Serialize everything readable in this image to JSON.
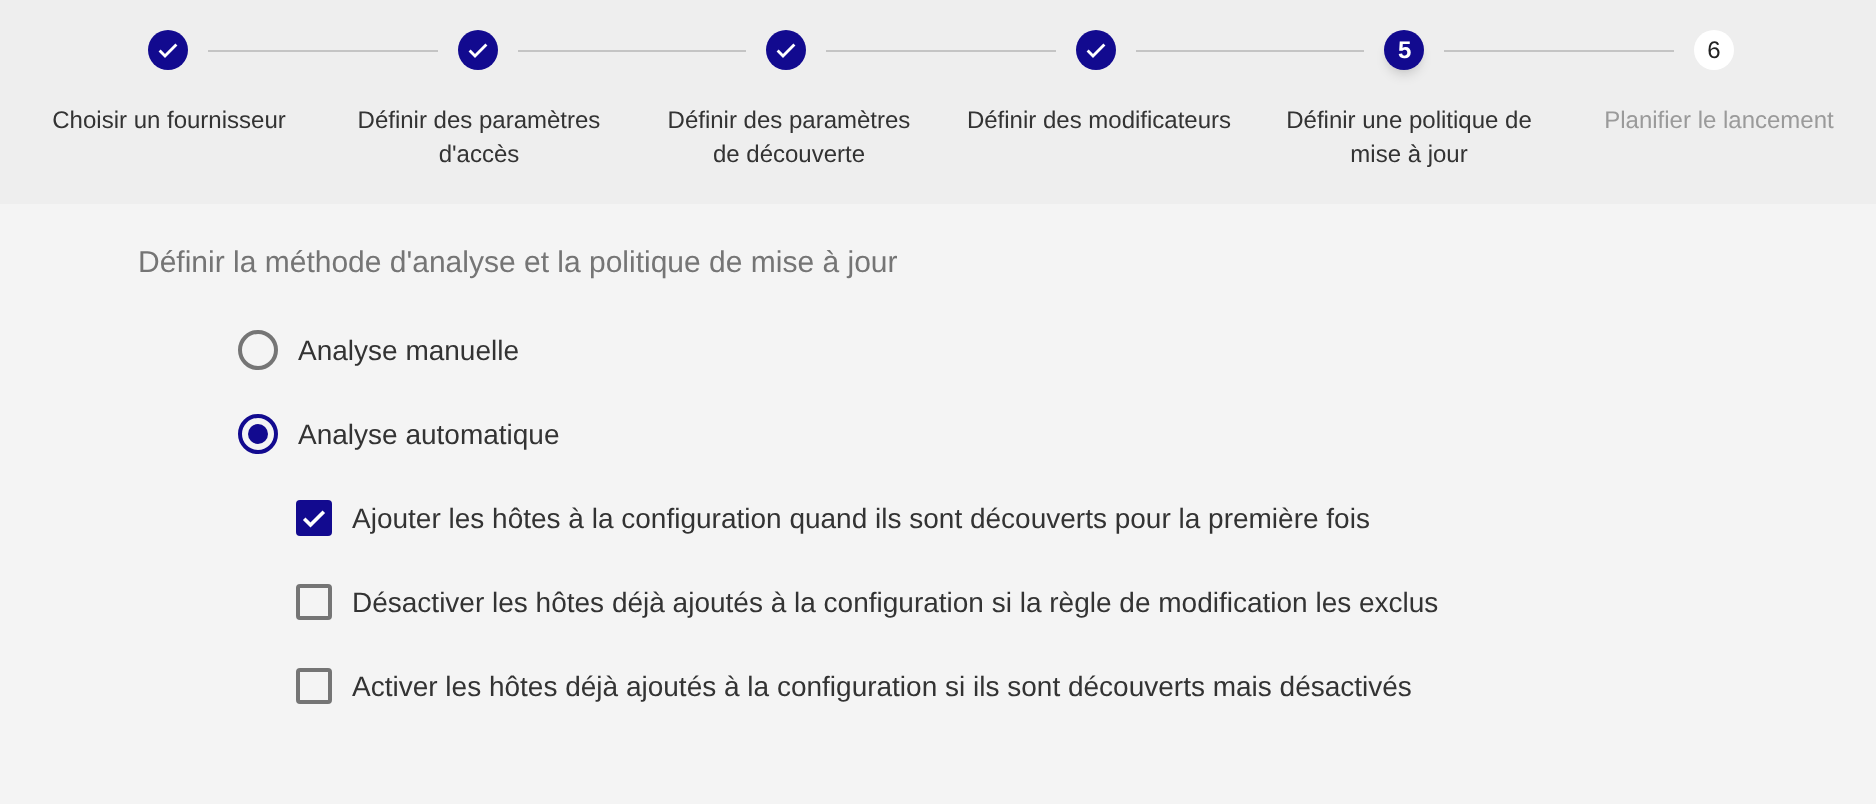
{
  "steps": [
    {
      "label": "Choisir un fournisseur",
      "kind": "completed"
    },
    {
      "label": "Définir des paramètres d'accès",
      "kind": "completed"
    },
    {
      "label": "Définir des paramètres de découverte",
      "kind": "completed"
    },
    {
      "label": "Définir des modificateurs",
      "kind": "completed"
    },
    {
      "number": "5",
      "label": "Définir une politique de mise à jour",
      "kind": "active"
    },
    {
      "number": "6",
      "label": "Planifier le lancement",
      "kind": "pending"
    }
  ],
  "section_title": "Définir la méthode d'analyse et la politique de mise à jour",
  "methods": [
    {
      "label": "Analyse manuelle",
      "selected": false
    },
    {
      "label": "Analyse automatique",
      "selected": true
    }
  ],
  "options": [
    {
      "label": "Ajouter les hôtes à la configuration quand ils sont découverts pour la première fois",
      "checked": true
    },
    {
      "label": "Désactiver les hôtes déjà ajoutés à la configuration si la règle de modification les exclus",
      "checked": false
    },
    {
      "label": "Activer les hôtes déjà ajoutés à la configuration si ils sont découverts mais désactivés",
      "checked": false
    }
  ]
}
